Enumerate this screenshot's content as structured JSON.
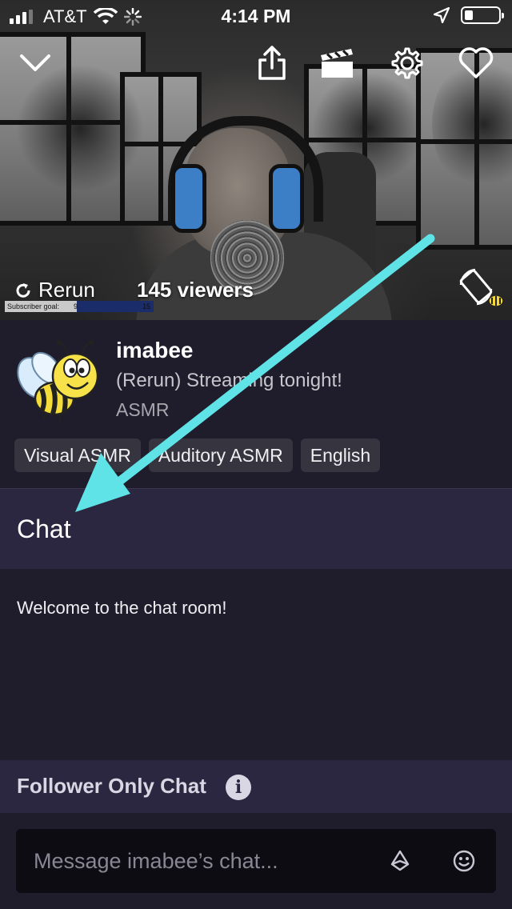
{
  "status_bar": {
    "carrier": "AT&T",
    "time": "4:14 PM",
    "icons": [
      "signal-icon",
      "wifi-icon",
      "activity-spinner-icon",
      "location-arrow-icon",
      "battery-icon"
    ]
  },
  "player": {
    "icons": [
      "chevron-down-icon",
      "share-icon",
      "clip-icon",
      "settings-gear-icon",
      "heart-icon",
      "rotate-screen-icon"
    ],
    "rerun_label": "Rerun",
    "viewers_label": "145 viewers",
    "subscriber_goal": {
      "label": "Subscriber goal:",
      "current": "9",
      "target": "15"
    }
  },
  "channel": {
    "name": "imabee",
    "title": "(Rerun) Streaming tonight!",
    "category": "ASMR",
    "tags": [
      "Visual ASMR",
      "Auditory ASMR",
      "English"
    ]
  },
  "chat": {
    "header": "Chat",
    "welcome": "Welcome to the chat room!",
    "follower_only": "Follower Only Chat",
    "placeholder": "Message imabee’s chat...",
    "icons": [
      "info-icon",
      "bits-icon",
      "emoji-icon"
    ]
  },
  "colors": {
    "background": "#1f1c2c",
    "header_bg": "#2b2740",
    "input_bg": "#0e0c13",
    "annotation_arrow": "#5fe3e6"
  }
}
